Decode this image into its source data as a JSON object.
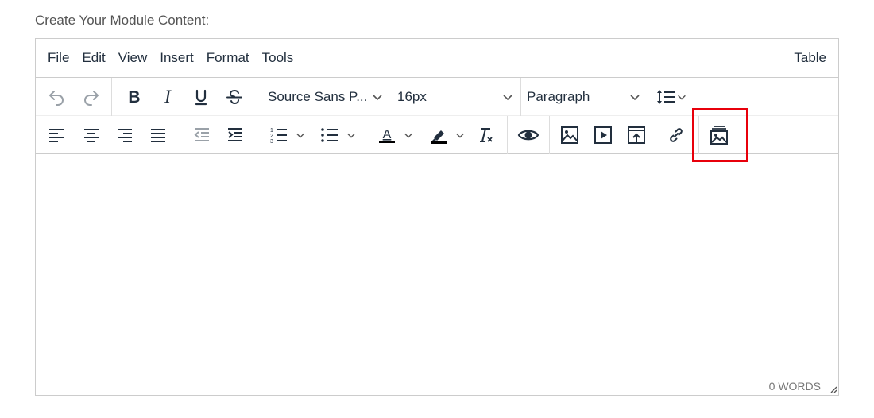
{
  "field_label": "Create Your Module Content:",
  "menubar": {
    "items": [
      "File",
      "Edit",
      "View",
      "Insert",
      "Format",
      "Tools"
    ],
    "right_item": "Table"
  },
  "toolbar": {
    "font_family": "Source Sans P...",
    "font_size": "16px",
    "block_format": "Paragraph"
  },
  "statusbar": {
    "word_count": "0 WORDS"
  },
  "highlight_color": "#e8000b"
}
